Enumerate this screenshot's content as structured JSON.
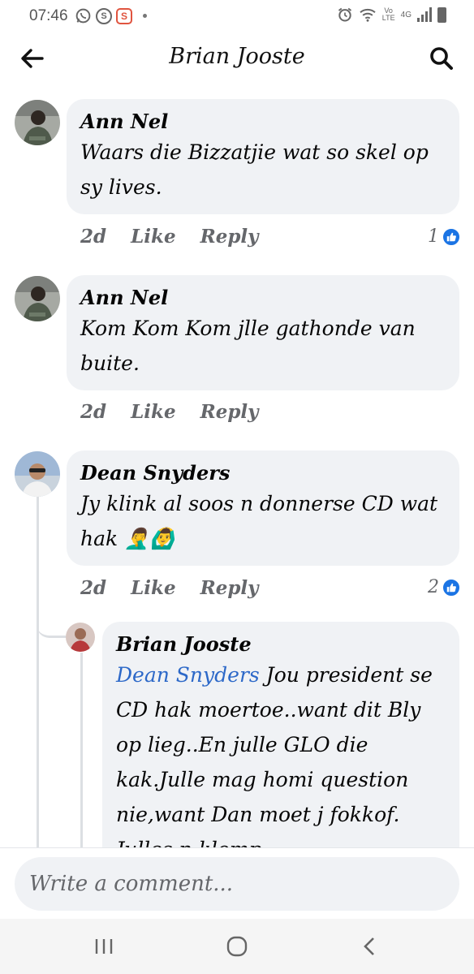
{
  "status_bar": {
    "time": "07:46",
    "icons": [
      "whatsapp-icon",
      "s-icon",
      "s-square-icon",
      "dot-icon",
      "alarm-icon",
      "wifi-icon",
      "volte-icon",
      "4g-icon",
      "signal-icon",
      "battery-icon"
    ],
    "volte_label": "Vo LTE",
    "network_label": "4G"
  },
  "header": {
    "title": "Brian Jooste"
  },
  "comments": [
    {
      "author": "Ann Nel",
      "text": "Waars die Bizzatjie wat so skel op sy lives.",
      "time": "2d",
      "like_label": "Like",
      "reply_label": "Reply",
      "reactions": "1"
    },
    {
      "author": "Ann Nel",
      "text": "Kom Kom Kom jlle gathonde van buite.",
      "time": "2d",
      "like_label": "Like",
      "reply_label": "Reply"
    },
    {
      "author": "Dean Snyders",
      "text": "Jy klink al soos n donnerse CD wat hak 🤦‍♂️🙆‍♂️",
      "time": "2d",
      "like_label": "Like",
      "reply_label": "Reply",
      "reactions": "2"
    }
  ],
  "reply": {
    "author": "Brian Jooste",
    "mention": "Dean Snyders",
    "text": " Jou president se CD hak moertoe..want dit Bly op lieg..En julle GLO die kak.Julle mag homi question nie,want Dan moet j fokkof. Julles n klomp"
  },
  "composer": {
    "placeholder": "Write a comment..."
  },
  "colors": {
    "bubble": "#f0f2f5",
    "mention": "#2c68c8",
    "like_blue": "#1b74e4",
    "secondary_text": "#65676b"
  }
}
